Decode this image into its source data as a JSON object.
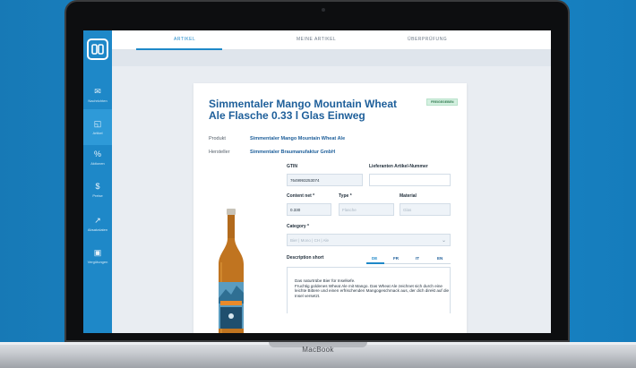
{
  "device_label": "MacBook",
  "sidebar": {
    "items": [
      {
        "label": "Nachrichten",
        "icon": "messages-icon"
      },
      {
        "label": "Artikel",
        "icon": "bottle-icon"
      },
      {
        "label": "Aktionen",
        "icon": "percent-icon"
      },
      {
        "label": "Preise",
        "icon": "dollar-icon"
      },
      {
        "label": "Absatzdaten",
        "icon": "chart-icon"
      },
      {
        "label": "Vergütungen",
        "icon": "gift-icon"
      }
    ],
    "active_index": 1
  },
  "tabs": [
    {
      "label": "ARTIKEL"
    },
    {
      "label": "MEINE ARTIKEL"
    },
    {
      "label": "ÜBERPRÜFUNG"
    }
  ],
  "product": {
    "title": "Simmentaler Mango Mountain Wheat Ale Flasche 0.33 l Glas Einweg",
    "badge": "FREIGEGEBEN",
    "produkt_label": "Produkt",
    "produkt_value": "Simmentaler Mango Mountain Wheat Ale",
    "hersteller_label": "Hersteller",
    "hersteller_value": "Simmentaler Braumanufaktur GmbH"
  },
  "form": {
    "gtin_label": "GTIN",
    "gtin_value": "7649993253074",
    "lieferanten_label": "Lieferanten Artikel-Nummer",
    "lieferanten_value": "",
    "content_label": "Content net *",
    "content_value": "0.330",
    "type_label": "Type *",
    "type_placeholder": "Flasche",
    "material_label": "Material",
    "material_placeholder": "Glas",
    "category_label": "Category *",
    "category_placeholder": "Bier | Mono | CH | Ale",
    "desc_label": "Description short",
    "languages": [
      "DE",
      "FR",
      "IT",
      "EN"
    ],
    "active_language": "DE",
    "desc_line1": "Das naturtrübe Bier für Inselkefe.",
    "desc_line2": "Fruchtig goldenes Wheat Ale mit Mango. Das Wheat Ale zeichnet sich durch eine leichte Bittere und einen erfrischenden Mangogeschmack aus, der dich direkt auf die Insel versetzt."
  },
  "colors": {
    "accent": "#1e88c8",
    "title": "#1e5f9a",
    "background": "#1a86c6",
    "badge_bg": "#d4f0e0"
  }
}
